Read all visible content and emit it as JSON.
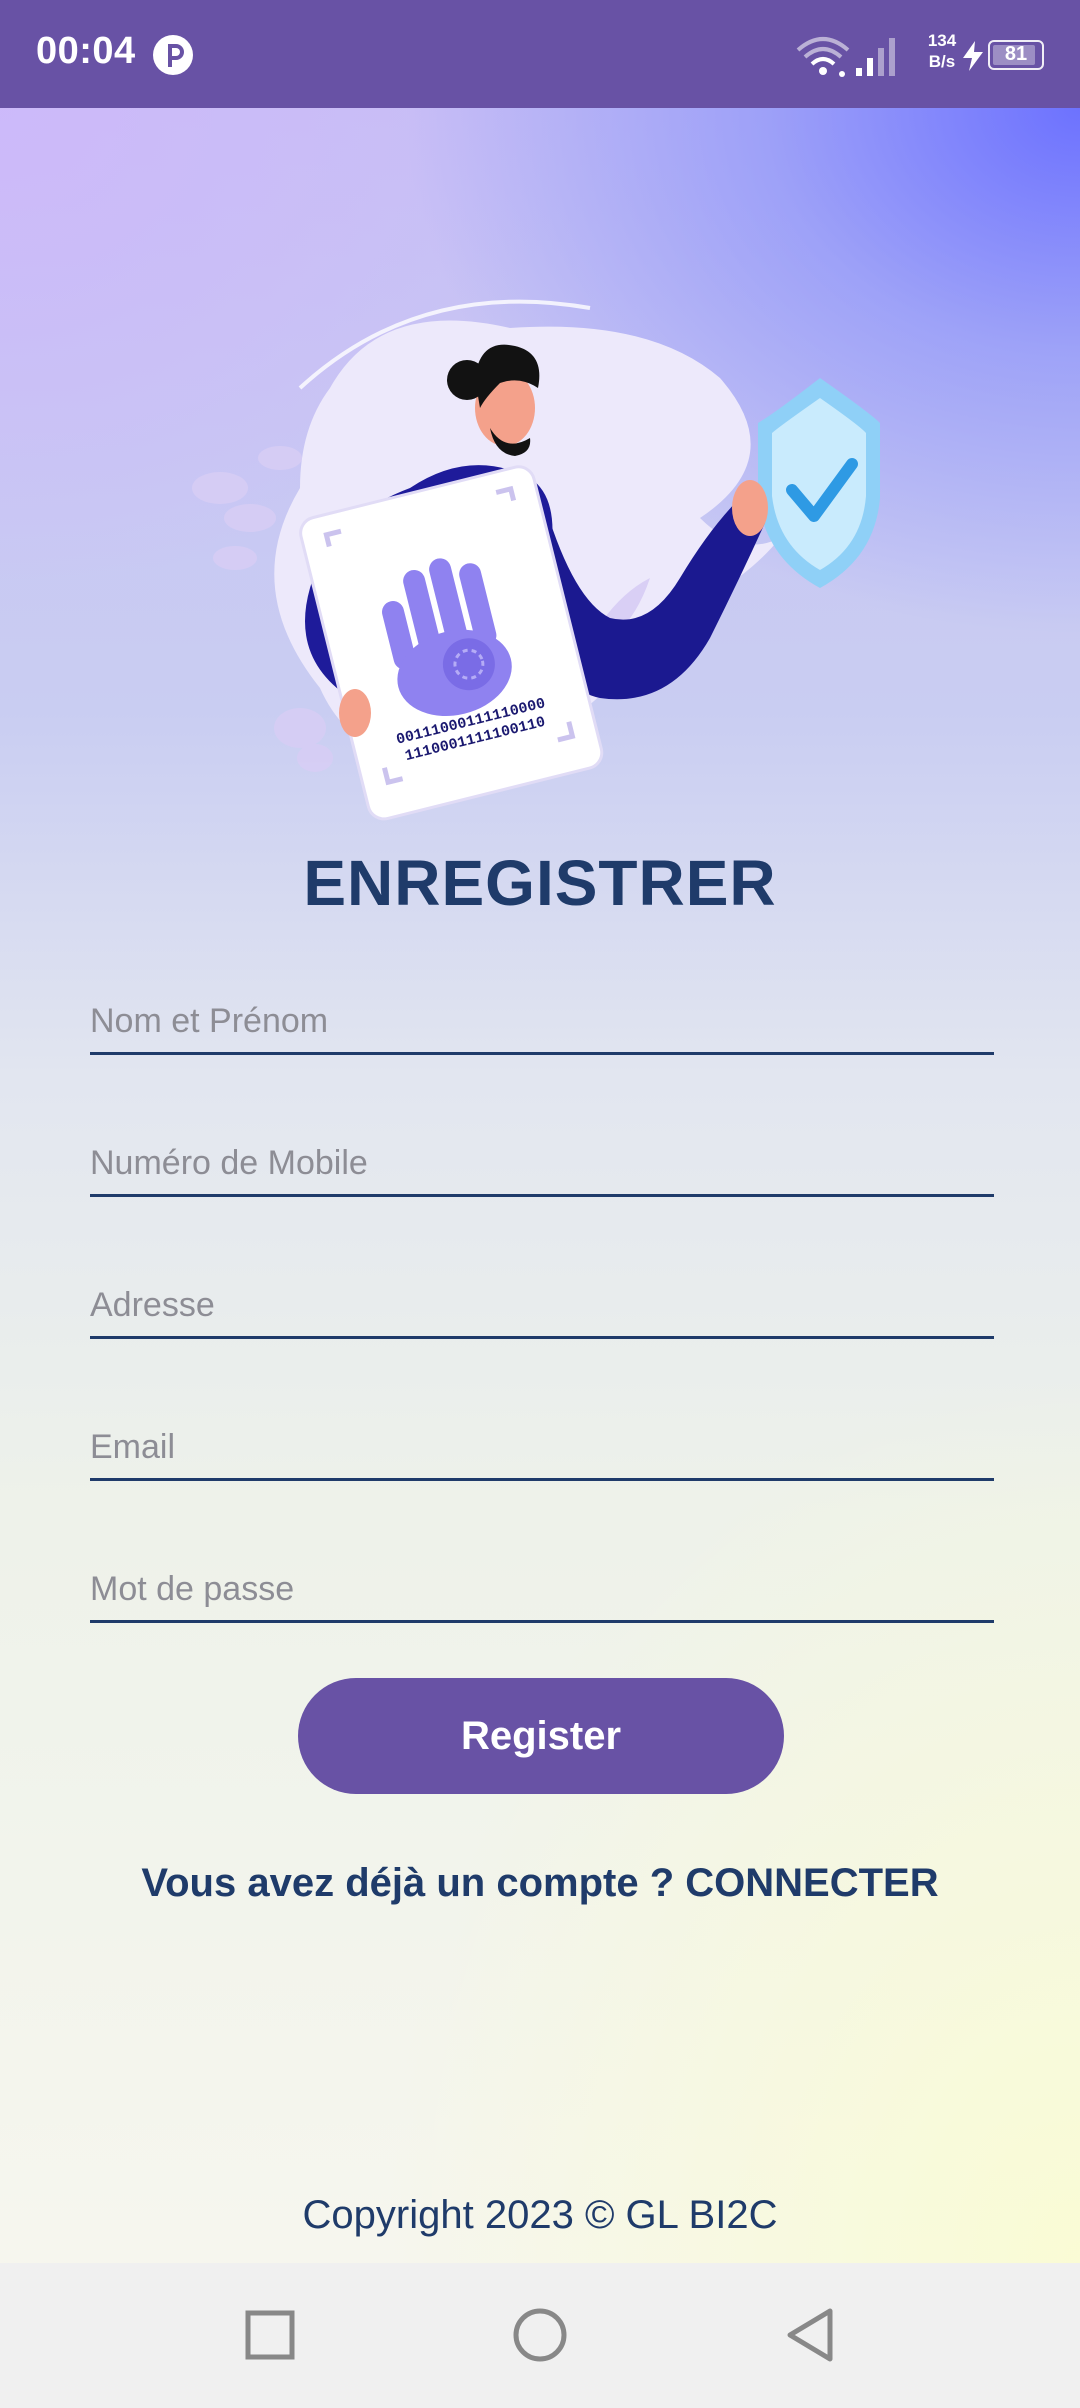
{
  "status_bar": {
    "time": "00:04",
    "net_speed_value": "134",
    "net_speed_unit": "B/s",
    "battery_level": "81"
  },
  "illustration": {
    "binary_line_1": "00111000111110000",
    "binary_line_2": "1110001111100110"
  },
  "form": {
    "title": "ENREGISTRER",
    "fields": [
      {
        "placeholder": "Nom et Prénom",
        "value": ""
      },
      {
        "placeholder": "Numéro de Mobile",
        "value": ""
      },
      {
        "placeholder": "Adresse",
        "value": ""
      },
      {
        "placeholder": "Email",
        "value": ""
      },
      {
        "placeholder": "Mot de passe",
        "value": ""
      }
    ],
    "submit_label": "Register",
    "login_prompt": "Vous avez déjà un compte ? CONNECTER"
  },
  "footer": {
    "copyright": "Copyright 2023 © GL BI2C"
  },
  "nav_bar": {
    "icons": [
      "recents-square-icon",
      "home-circle-icon",
      "back-triangle-icon"
    ]
  },
  "colors": {
    "primary": "#6852a5",
    "text_dark": "#1f3b6a",
    "placeholder": "#8d8d95"
  }
}
